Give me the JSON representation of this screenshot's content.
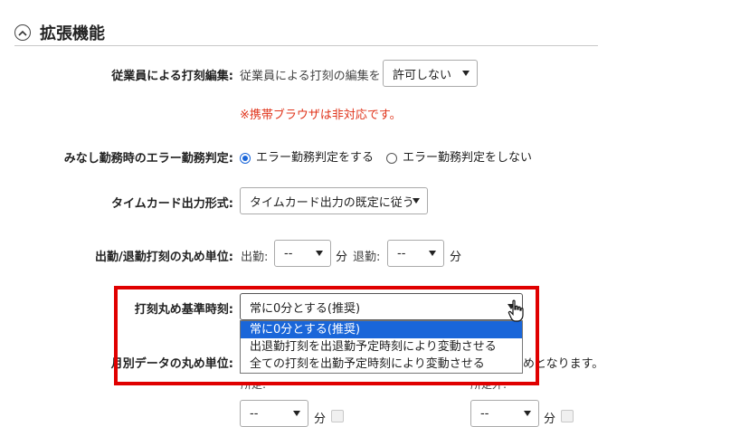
{
  "section": {
    "title": "拡張機能",
    "icon": "chevron-up-icon"
  },
  "rows": {
    "clock_edit": {
      "label": "従業員による打刻編集:",
      "prefix": "従業員による打刻の編集を",
      "select_value": "許可しない",
      "warning": "※携帯ブラウザは非対応です。"
    },
    "error_judgement": {
      "label": "みなし勤務時のエラー勤務判定:",
      "options": [
        "エラー勤務判定をする",
        "エラー勤務判定をしない"
      ],
      "selected_index": 0
    },
    "timecard_format": {
      "label": "タイムカード出力形式:",
      "select_value": "タイムカード出力の既定に従う"
    },
    "rounding_unit": {
      "label": "出勤/退勤打刻の丸め単位:",
      "clock_in_label": "出勤:",
      "clock_in_value": "--",
      "clock_out_label": "退勤:",
      "clock_out_value": "--",
      "unit": "分"
    },
    "rounding_base": {
      "label": "打刻丸め基準時刻:",
      "select_value": "常に0分とする(推奨)",
      "options": [
        "常に0分とする(推奨)",
        "出退勤打刻を出退勤予定時刻により変動させる",
        "全ての打刻を出勤予定時刻により変動させる"
      ],
      "selected_index": 0
    },
    "monthly_rounding": {
      "label": "月別データの丸め単位:",
      "trailing_text": "めとなります。",
      "scheduled_label": "所定:",
      "non_scheduled_label": "所定外:",
      "scheduled_value": "--",
      "non_scheduled_value": "--",
      "unit": "分"
    }
  },
  "colors": {
    "accent": "#1a66d9",
    "warning": "#e0341b",
    "highlight": "#e00000"
  }
}
